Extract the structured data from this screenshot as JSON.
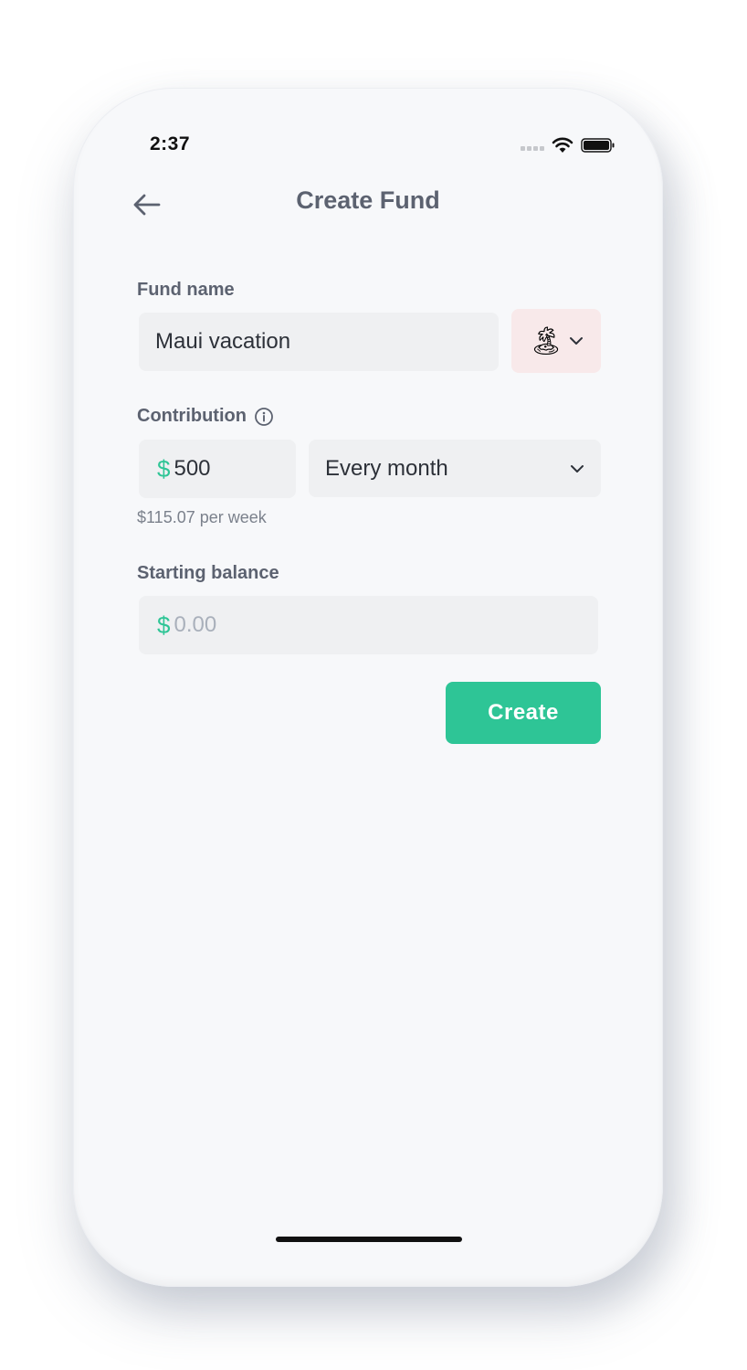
{
  "status_bar": {
    "time": "2:37"
  },
  "header": {
    "title": "Create Fund"
  },
  "fund_name": {
    "label": "Fund name",
    "value": "Maui vacation",
    "emoji": "🏝"
  },
  "contribution": {
    "label": "Contribution",
    "currency_symbol": "$",
    "amount": "500",
    "frequency": "Every month",
    "per_week_hint": "$115.07 per week"
  },
  "starting_balance": {
    "label": "Starting balance",
    "currency_symbol": "$",
    "placeholder": "0.00"
  },
  "actions": {
    "create_label": "Create"
  },
  "colors": {
    "accent": "#2ec596",
    "label": "#5c6270",
    "field_bg": "#eff0f2",
    "emoji_bg": "#f8e9ea"
  }
}
